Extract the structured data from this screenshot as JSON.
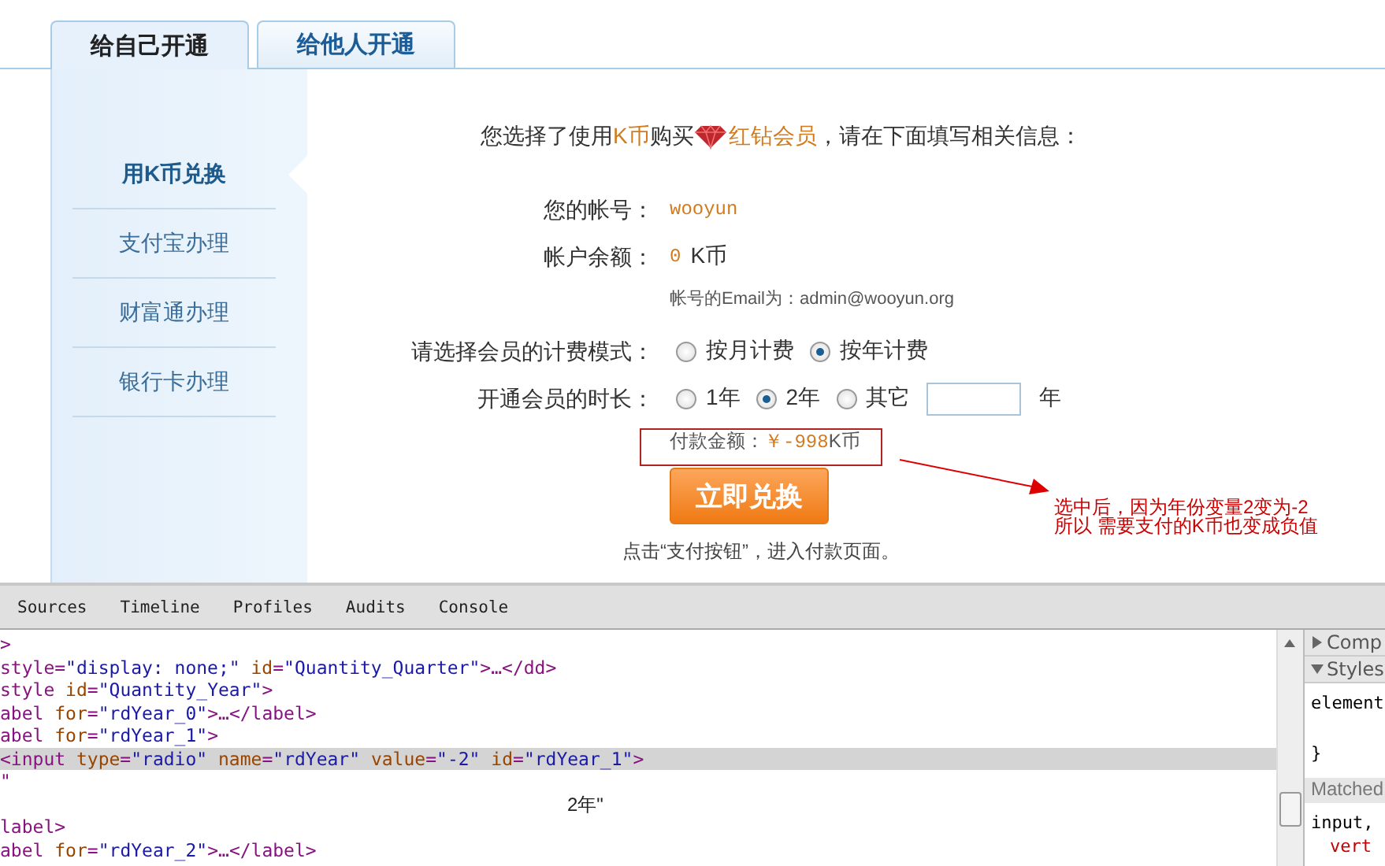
{
  "tabs": [
    {
      "label": "给自己开通",
      "selected": true
    },
    {
      "label": "给他人开通",
      "selected": false
    }
  ],
  "sidebar": {
    "items": [
      {
        "label": "用K币兑换",
        "selected": true
      },
      {
        "label": "支付宝办理",
        "selected": false
      },
      {
        "label": "财富通办理",
        "selected": false
      },
      {
        "label": "银行卡办理",
        "selected": false
      }
    ]
  },
  "intro": [
    {
      "text": "您选择了使用",
      "kind": "plain"
    },
    {
      "text": "K币",
      "kind": "highlight"
    },
    {
      "text": "购买",
      "kind": "plain"
    },
    {
      "text": "红钻会员",
      "kind": "product"
    },
    {
      "text": "，请在下面填写相关信息：",
      "kind": "plain"
    }
  ],
  "account": {
    "label": "您的帐号：",
    "value": "wooyun"
  },
  "balance": {
    "label": "帐户余额：",
    "amount": "0",
    "unit": "K币"
  },
  "email_note": "帐号的Email为：admin@wooyun.org",
  "billing_mode": {
    "label": "请选择会员的计费模式：",
    "options": [
      {
        "label": "按月计费",
        "selected": false
      },
      {
        "label": "按年计费",
        "selected": true
      }
    ]
  },
  "duration": {
    "label": "开通会员的时长：",
    "options": [
      {
        "label": "1年",
        "selected": false
      },
      {
        "label": "2年",
        "selected": true
      },
      {
        "label": "其它",
        "selected": false
      }
    ],
    "unit": "年"
  },
  "payment": {
    "label": "付款金额：",
    "amount": "￥-998",
    "unit": "K币"
  },
  "submit_button": "立即兑换",
  "hint": "点击“支付按钮”，进入付款页面。",
  "annotation": {
    "lines": [
      "选中后，因为年份变量2变为-2",
      "所以 需要支付的K币也变成负值"
    ]
  },
  "devtools": {
    "tabs": [
      "Sources",
      "Timeline",
      "Profiles",
      "Audits",
      "Console"
    ],
    "code_lines": [
      {
        "text": ">",
        "kind": "code",
        "selected": false
      },
      {
        "text": "style=\"display: none;\" id=\"Quantity_Quarter\">…</dd>",
        "kind": "code",
        "selected": false
      },
      {
        "text": "style id=\"Quantity_Year\">",
        "kind": "code",
        "selected": false
      },
      {
        "text": "abel for=\"rdYear_0\">…</label>",
        "kind": "code",
        "selected": false
      },
      {
        "text": "abel for=\"rdYear_1\">",
        "kind": "code",
        "selected": false
      },
      {
        "text": "<input type=\"radio\" name=\"rdYear\" value=\"-2\" id=\"rdYear_1\">",
        "kind": "code",
        "selected": true
      },
      {
        "text": "\"",
        "kind": "code",
        "selected": false
      },
      {
        "text": "2年\"",
        "kind": "text-node",
        "selected": false
      },
      {
        "text": "label>",
        "kind": "code",
        "selected": false
      },
      {
        "text": "abel for=\"rdYear_2\">…</label>",
        "kind": "code",
        "selected": false
      }
    ],
    "styles_pane": [
      {
        "text": "Comp",
        "kind": "section",
        "expanded": false
      },
      {
        "text": "Styles",
        "kind": "section",
        "expanded": true
      },
      {
        "text": "element",
        "kind": "code"
      },
      {
        "text": "}",
        "kind": "code"
      },
      {
        "text": "Matched",
        "kind": "header"
      },
      {
        "text": "input,",
        "kind": "code"
      },
      {
        "text": "vert",
        "kind": "property"
      }
    ]
  }
}
